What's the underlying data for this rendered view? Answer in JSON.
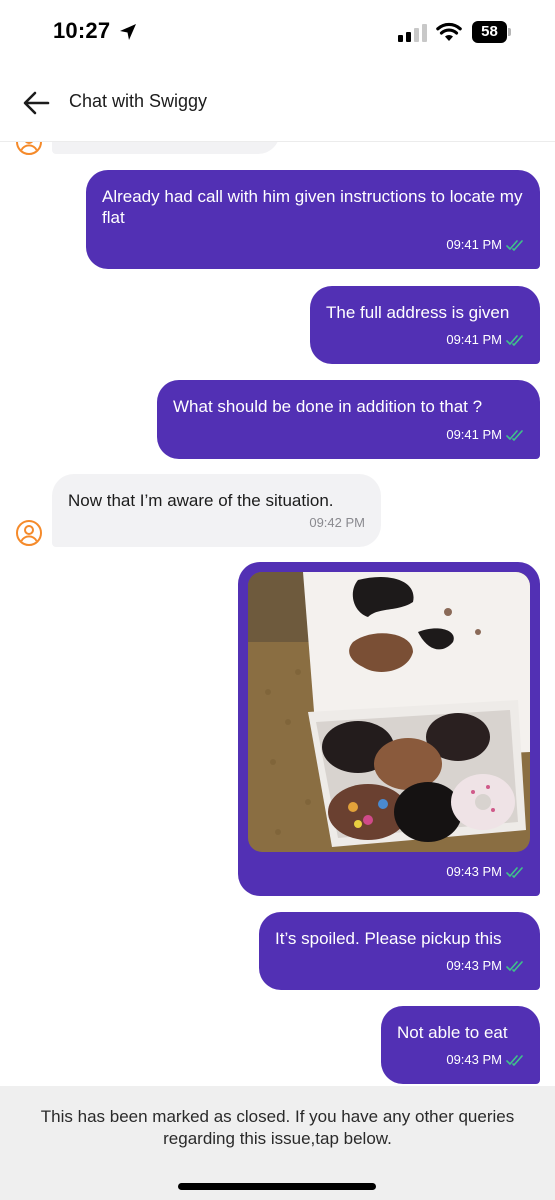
{
  "status_bar": {
    "time": "10:27",
    "battery": "58",
    "location_icon": "location-arrow-icon",
    "signal_icon": "cellular-signal-icon",
    "wifi_icon": "wifi-icon"
  },
  "header": {
    "back_icon": "arrow-left-icon",
    "title": "Chat with Swiggy"
  },
  "messages": [
    {
      "direction": "outgoing",
      "text": "Already had call with him given instructions to locate my flat",
      "time": "09:41 PM",
      "status_icon": "double-check-icon"
    },
    {
      "direction": "outgoing",
      "text": "The full address is given",
      "time": "09:41 PM",
      "status_icon": "double-check-icon"
    },
    {
      "direction": "outgoing",
      "text": "What should be done in addition to that ?",
      "time": "09:41 PM",
      "status_icon": "double-check-icon"
    },
    {
      "direction": "incoming",
      "text": "Now that I’m aware of the situation.",
      "time": "09:42 PM",
      "avatar_icon": "agent-avatar-icon"
    },
    {
      "direction": "outgoing",
      "type": "image",
      "image_subject": "box-of-spoiled-donuts-photo",
      "time": "09:43 PM",
      "status_icon": "double-check-icon"
    },
    {
      "direction": "outgoing",
      "text": "It’s spoiled. Please pickup this",
      "time": "09:43 PM",
      "status_icon": "double-check-icon"
    },
    {
      "direction": "outgoing",
      "text": "Not able to eat",
      "time": "09:43 PM",
      "status_icon": "double-check-icon"
    }
  ],
  "closed_notice": "This has been marked as closed. If you have any other queries regarding this issue,tap below.",
  "colors": {
    "outgoing_bubble": "#5230b4",
    "incoming_bubble": "#f2f2f4",
    "read_tick": "#3fc38a",
    "agent_avatar": "#f58a2a"
  }
}
